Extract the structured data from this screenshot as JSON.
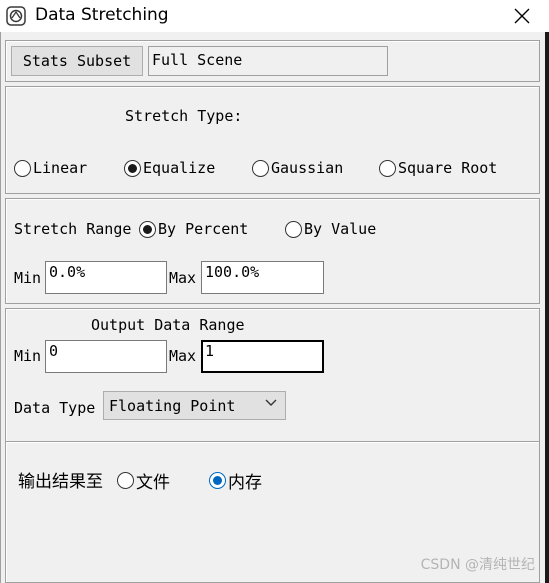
{
  "window": {
    "title": "Data Stretching"
  },
  "stats": {
    "button_label": "Stats Subset",
    "value": "Full Scene"
  },
  "stretch_type": {
    "heading": "Stretch Type:",
    "options": [
      {
        "label": "Linear",
        "selected": false
      },
      {
        "label": "Equalize",
        "selected": true
      },
      {
        "label": "Gaussian",
        "selected": false
      },
      {
        "label": "Square Root",
        "selected": false
      }
    ]
  },
  "stretch_range": {
    "label": "Stretch Range",
    "options": [
      {
        "label": "By Percent",
        "selected": true
      },
      {
        "label": "By Value",
        "selected": false
      }
    ],
    "min_label": "Min",
    "min_value": "0.0%",
    "max_label": "Max",
    "max_value": "100.0%"
  },
  "output_range": {
    "heading": "Output Data Range",
    "min_label": "Min",
    "min_value": "0",
    "max_label": "Max",
    "max_value": "1",
    "data_type_label": "Data Type",
    "data_type_value": "Floating Point"
  },
  "output_to": {
    "label": "输出结果至",
    "options": [
      {
        "label": "文件",
        "selected": false
      },
      {
        "label": "内存",
        "selected": true
      }
    ]
  },
  "watermark": "CSDN @清纯世纪"
}
